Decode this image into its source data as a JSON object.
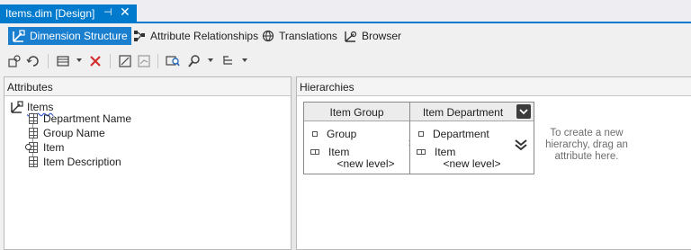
{
  "document_tab": {
    "title": "Items.dim [Design]",
    "pin_glyph": "⊣",
    "close_glyph": "✕"
  },
  "designer_tabs": [
    {
      "label": "Dimension Structure",
      "icon": "dimension-structure-icon",
      "active": true
    },
    {
      "label": "Attribute Relationships",
      "icon": "attribute-relationships-icon",
      "active": false
    },
    {
      "label": "Translations",
      "icon": "translations-icon",
      "active": false
    },
    {
      "label": "Browser",
      "icon": "browser-icon",
      "active": false
    }
  ],
  "toolbar_icons": [
    "process-icon",
    "reconnect-icon",
    "show-grid-icon",
    "delete-icon",
    "auto-size-icon",
    "layout-icon",
    "find-icon",
    "zoom-icon",
    "hierarchy-view-icon"
  ],
  "attributes_pane": {
    "header": "Attributes",
    "root": {
      "label": "Items",
      "icon": "dimension-icon"
    },
    "items": [
      {
        "label": "Department Name",
        "icon": "attribute-icon"
      },
      {
        "label": "Group Name",
        "icon": "attribute-icon"
      },
      {
        "label": "Item",
        "icon": "key-attribute-icon"
      },
      {
        "label": "Item Description",
        "icon": "attribute-icon"
      }
    ]
  },
  "hierarchies_pane": {
    "header": "Hierarchies",
    "hierarchies": [
      {
        "name": "Item Group",
        "levels": [
          "Group",
          "Item"
        ],
        "new_level": "<new level>"
      },
      {
        "name": "Item Department",
        "levels": [
          "Department",
          "Item"
        ],
        "new_level": "<new level>"
      }
    ],
    "hint": "To create a new hierarchy, drag an attribute here."
  },
  "colors": {
    "accent": "#007acc",
    "active_tab": "#1a7fcf",
    "hint_text": "#6d6d6d"
  }
}
